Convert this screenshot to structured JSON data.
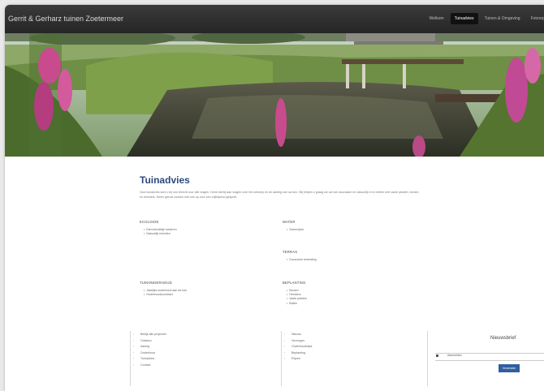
{
  "site": {
    "title": "Gerrit & Gerharz tuinen Zoetermeer"
  },
  "nav": {
    "items": [
      "Welkom",
      "Tuinadvies",
      "Tuinen & Omgeving",
      "Fotoreportage"
    ],
    "active_index": 1
  },
  "main": {
    "title": "Tuinadvies",
    "intro": "Voor tuinadvies kunt u bij ons terecht voor alle vragen. Denk hierbij aan vragen over het ontwerp en de aanleg van uw tuin. Wij helpen u graag om uw tuin duurzaam en natuurlijk in te richten met vaste planten, bomen en heesters. Neem gerust contact met ons op voor een vrijblijvend gesprek."
  },
  "sections": {
    "ecologisch": {
      "heading": "Ecologie",
      "items": [
        "Diervriendelijk tuinieren",
        "Natuurlijk inrichten"
      ]
    },
    "water": {
      "heading": "Water",
      "items": [
        "Zwemvijver"
      ]
    },
    "terras": {
      "heading": "Terras",
      "items": [
        "Duurzame bestrating"
      ]
    },
    "tuinonderhoud": {
      "heading": "Tuinonderhoud",
      "items": [
        "Jaarlijks onderhoud aan de tuin",
        "Onderhoudscontract"
      ]
    },
    "beplanting": {
      "heading": "Beplanting",
      "items": [
        "Bomen",
        "Heesters",
        "Vaste planten",
        "Bollen"
      ]
    }
  },
  "footer": {
    "col1": [
      "Bekijk alle projecten",
      "Ontwerp",
      "Aanleg",
      "Onderhoud",
      "Tuinadvies",
      "Contact"
    ],
    "col2": [
      "Nieuws",
      "Verzorgen",
      "Onderhoudstips",
      "Beplanting",
      "Prijzen"
    ]
  },
  "newsletter": {
    "title": "Nieuwsbrief",
    "checkbox_label": "Aanmelden",
    "button": "Verzenden"
  }
}
